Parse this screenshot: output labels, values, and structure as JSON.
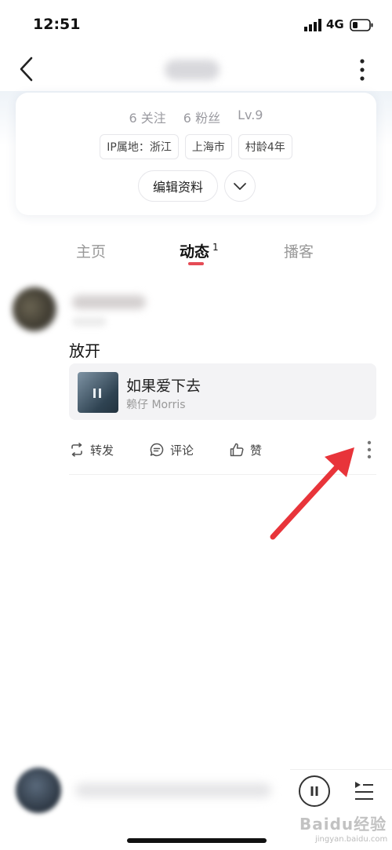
{
  "status_bar": {
    "time": "12:51",
    "network": "4G"
  },
  "profile": {
    "stats": {
      "following": "6 关注",
      "followers": "6 粉丝",
      "level": "Lv.9"
    },
    "tags": [
      "IP属地：浙江",
      "上海市",
      "村龄4年"
    ],
    "edit_label": "编辑资料"
  },
  "tabs": {
    "home": "主页",
    "feed": "动态",
    "feed_count": "1",
    "podcast": "播客"
  },
  "post": {
    "text": "放开",
    "song": {
      "title": "如果爱下去",
      "artist": "赖仔 Morris"
    },
    "actions": {
      "repost": "转发",
      "comment": "评论",
      "like": "赞"
    }
  },
  "watermark": {
    "brand": "Baidu经验",
    "url": "jingyan.baidu.com"
  },
  "colors": {
    "accent": "#e54b55",
    "arrow": "#e8343a"
  }
}
